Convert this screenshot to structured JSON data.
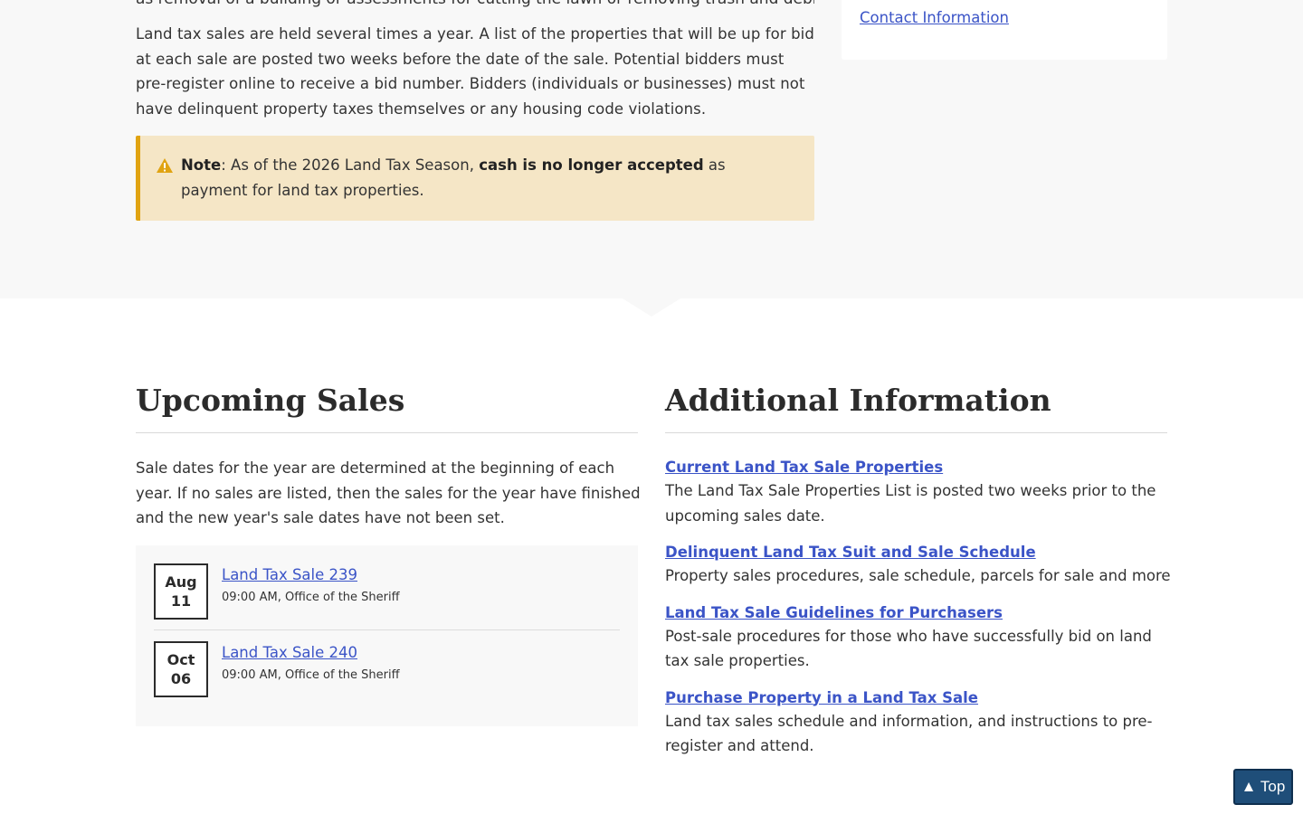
{
  "intro": {
    "cut_line": "as removal of a building or assessments for cutting the lawn or removing trash and debris.",
    "paragraph": "Land tax sales are held several times a year. A list of the properties that will be up for bid at each sale are posted two weeks before the date of the sale. Potential bidders must pre-register online to receive a bid number. Bidders (individuals or businesses) must not have delinquent property taxes themselves or any housing code violations.",
    "note": {
      "icon": "warning-icon",
      "label": "Note",
      "text_before": ": As of the 2026 Land Tax Season, ",
      "emphasis": "cash is no longer accepted",
      "text_after": " as payment for land tax properties."
    }
  },
  "sidebar": {
    "contact_link": "Contact Information"
  },
  "upcoming": {
    "title": "Upcoming Sales",
    "description": "Sale dates for the year are determined at the beginning of each year. If no sales are listed, then the sales for the year have finished and the new year's sale dates have not been set.",
    "events": [
      {
        "month": "Aug",
        "day": "11",
        "title": "Land Tax Sale 239",
        "meta": "09:00 AM, Office of the Sheriff"
      },
      {
        "month": "Oct",
        "day": "06",
        "title": "Land Tax Sale 240",
        "meta": "09:00 AM, Office of the Sheriff"
      }
    ]
  },
  "additional": {
    "title": "Additional Information",
    "items": [
      {
        "link": "Current Land Tax Sale Properties",
        "desc": "The Land Tax Sale Properties List is posted two weeks prior to the upcoming sales date."
      },
      {
        "link": "Delinquent Land Tax Suit and Sale Schedule",
        "desc": "Property sales procedures, sale schedule, parcels for sale and more"
      },
      {
        "link": "Land Tax Sale Guidelines for Purchasers",
        "desc": "Post-sale procedures for those who have successfully bid on land tax sale properties."
      },
      {
        "link": "Purchase Property in a Land Tax Sale",
        "desc": "Land tax sales schedule and information, and instructions to pre-register and attend."
      }
    ]
  },
  "back_to_top": "▲ Top",
  "colors": {
    "link": "#3b54c7",
    "note_bg": "#f5e6c6",
    "note_border": "#e0a312",
    "band_bg": "#f8f8f8",
    "top_button": "#1f4e79"
  }
}
